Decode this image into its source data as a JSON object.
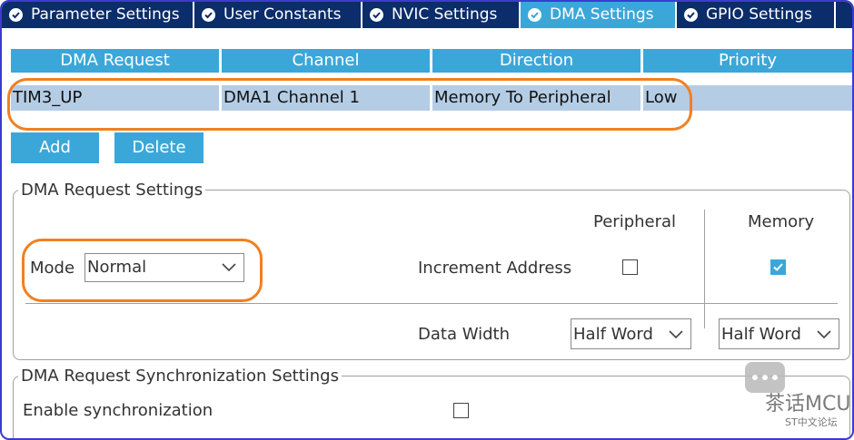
{
  "tabs": [
    {
      "label": "Parameter Settings",
      "active": false
    },
    {
      "label": "User Constants",
      "active": false
    },
    {
      "label": "NVIC Settings",
      "active": false
    },
    {
      "label": "DMA Settings",
      "active": true
    },
    {
      "label": "GPIO Settings",
      "active": false
    }
  ],
  "table": {
    "headers": [
      "DMA Request",
      "Channel",
      "Direction",
      "Priority"
    ],
    "rows": [
      [
        "TIM3_UP",
        "DMA1 Channel 1",
        "Memory To Peripheral",
        "Low"
      ]
    ]
  },
  "buttons": {
    "add": "Add",
    "delete": "Delete"
  },
  "request_settings": {
    "title": "DMA Request Settings",
    "peripheral_label": "Peripheral",
    "memory_label": "Memory",
    "mode_label": "Mode",
    "mode_value": "Normal",
    "increment_label": "Increment Address",
    "peripheral_increment": false,
    "memory_increment": true,
    "data_width_label": "Data Width",
    "peripheral_width": "Half Word",
    "memory_width": "Half Word"
  },
  "sync_settings": {
    "title": "DMA Request Synchronization Settings",
    "enable_label": "Enable synchronization",
    "enabled": false
  },
  "watermark": {
    "brand": "茶话MCU",
    "sub": "ST中文论坛"
  },
  "colors": {
    "tab_bar": "#0b2d6b",
    "accent": "#3ba7d9",
    "row_selected": "#b4cde5",
    "highlight": "#f08020"
  }
}
